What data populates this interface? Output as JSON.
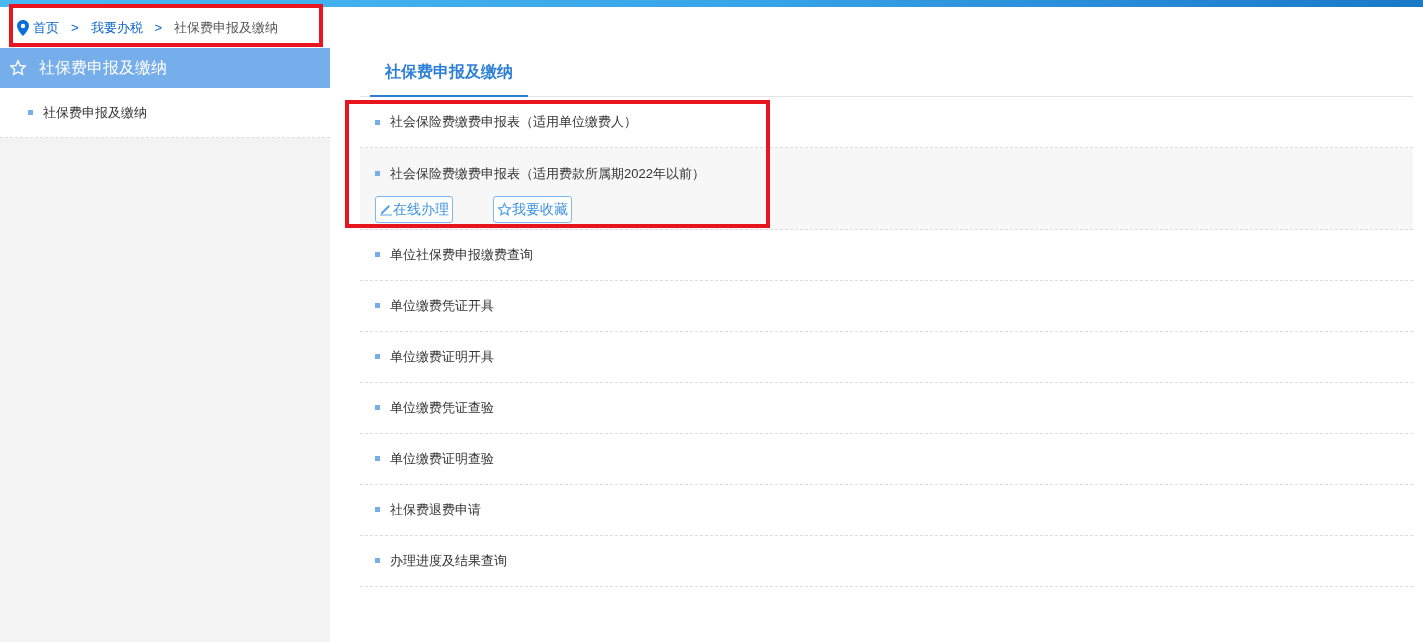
{
  "breadcrumb": [
    {
      "label": "首页",
      "kind": "link"
    },
    {
      "label": ">",
      "kind": "separator"
    },
    {
      "label": "我要办税",
      "kind": "link"
    },
    {
      "label": ">",
      "kind": "separator"
    },
    {
      "label": "社保费申报及缴纳",
      "kind": "current"
    }
  ],
  "sidebar": {
    "title": "社保费申报及缴纳",
    "items": [
      {
        "label": "社保费申报及缴纳"
      }
    ]
  },
  "tabs": [
    {
      "label": "社保费申报及缴纳",
      "selected": true
    }
  ],
  "items": [
    {
      "label": "社会保险费缴费申报表（适用单位缴费人）",
      "expanded": false
    },
    {
      "label": "社会保险费缴费申报表（适用费款所属期2022年以前）",
      "expanded": true,
      "actions": [
        {
          "label": "在线办理",
          "kind": "edit"
        },
        {
          "label": "我要收藏",
          "kind": "favorite"
        }
      ]
    },
    {
      "label": "单位社保费申报缴费查询",
      "expanded": false
    },
    {
      "label": "单位缴费凭证开具",
      "expanded": false
    },
    {
      "label": "单位缴费证明开具",
      "expanded": false
    },
    {
      "label": "单位缴费凭证查验",
      "expanded": false
    },
    {
      "label": "单位缴费证明查验",
      "expanded": false
    },
    {
      "label": "社保费退费申请",
      "expanded": false
    },
    {
      "label": "办理进度及结果查询",
      "expanded": false
    }
  ]
}
